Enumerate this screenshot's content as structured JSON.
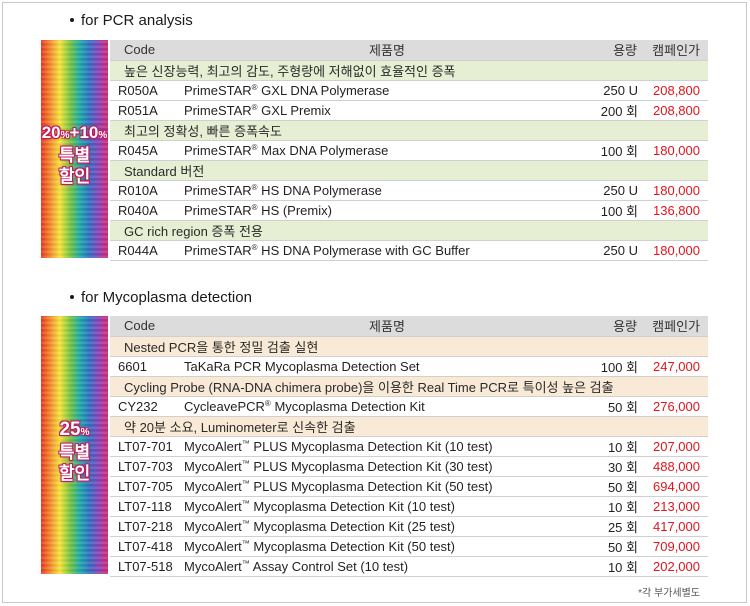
{
  "pcr": {
    "title": "for PCR analysis",
    "badge_pct": "20",
    "badge_pct_unit": "%",
    "badge_pct2": "+10",
    "badge_pct2_unit": "%",
    "badge_line1": "특별",
    "badge_line2": "할인",
    "headers": {
      "code": "Code",
      "name": "제품명",
      "qty": "용량",
      "price": "캠페인가"
    },
    "rows": [
      {
        "type": "cat",
        "text": "높은 신장능력, 최고의 감도, 주형량에 저해없이 효율적인 증폭"
      },
      {
        "type": "item",
        "code": "R050A",
        "name_a": "PrimeSTAR",
        "mark": "®",
        "name_b": " GXL DNA Polymerase",
        "qty": "250 U",
        "price": "208,800"
      },
      {
        "type": "item",
        "code": "R051A",
        "name_a": "PrimeSTAR",
        "mark": "®",
        "name_b": " GXL Premix",
        "qty": "200 회",
        "price": "208,800"
      },
      {
        "type": "cat",
        "text": "최고의 정확성, 빠른 증폭속도"
      },
      {
        "type": "item",
        "code": "R045A",
        "name_a": "PrimeSTAR",
        "mark": "®",
        "name_b": " Max DNA Polymerase",
        "qty": "100 회",
        "price": "180,000"
      },
      {
        "type": "cat",
        "text": "Standard 버전"
      },
      {
        "type": "item",
        "code": "R010A",
        "name_a": "PrimeSTAR",
        "mark": "®",
        "name_b": " HS DNA Polymerase",
        "qty": "250 U",
        "price": "180,000"
      },
      {
        "type": "item",
        "code": "R040A",
        "name_a": "PrimeSTAR",
        "mark": "®",
        "name_b": " HS (Premix)",
        "qty": "100 회",
        "price": "136,800"
      },
      {
        "type": "cat",
        "text": "GC rich region 증폭 전용"
      },
      {
        "type": "item",
        "code": "R044A",
        "name_a": "PrimeSTAR",
        "mark": "®",
        "name_b": " HS DNA Polymerase with GC Buffer",
        "qty": "250 U",
        "price": "180,000"
      }
    ]
  },
  "myco": {
    "title": "for Mycoplasma detection",
    "badge_pct": "25",
    "badge_pct_unit": "%",
    "badge_line1": "특별",
    "badge_line2": "할인",
    "headers": {
      "code": "Code",
      "name": "제품명",
      "qty": "용량",
      "price": "캠페인가"
    },
    "rows": [
      {
        "type": "cat",
        "text": "Nested PCR을 통한 정밀 검출 실현"
      },
      {
        "type": "item",
        "code": "6601",
        "name_a": "TaKaRa PCR Mycoplasma Detection Set",
        "mark": "",
        "name_b": "",
        "qty": "100 회",
        "price": "247,000"
      },
      {
        "type": "cat",
        "text": "Cycling Probe (RNA-DNA chimera probe)을 이용한 Real Time PCR로 특이성 높은 검출"
      },
      {
        "type": "item",
        "code": "CY232",
        "name_a": "CycleavePCR",
        "mark": "®",
        "name_b": " Mycoplasma Detection Kit",
        "qty": "50 회",
        "price": "276,000"
      },
      {
        "type": "cat",
        "text": "약 20분 소요, Luminometer로 신속한 검출"
      },
      {
        "type": "item",
        "code": "LT07-701",
        "name_a": "MycoAlert",
        "mark": "™",
        "name_b": " PLUS Mycoplasma Detection Kit (10 test)",
        "qty": "10 회",
        "price": "207,000"
      },
      {
        "type": "item",
        "code": "LT07-703",
        "name_a": "MycoAlert",
        "mark": "™",
        "name_b": " PLUS Mycoplasma Detection Kit (30 test)",
        "qty": "30 회",
        "price": "488,000"
      },
      {
        "type": "item",
        "code": "LT07-705",
        "name_a": "MycoAlert",
        "mark": "™",
        "name_b": " PLUS Mycoplasma Detection Kit (50 test)",
        "qty": "50 회",
        "price": "694,000"
      },
      {
        "type": "item",
        "code": "LT07-118",
        "name_a": "MycoAlert",
        "mark": "™",
        "name_b": " Mycoplasma Detection Kit (10 test)",
        "qty": "10 회",
        "price": "213,000"
      },
      {
        "type": "item",
        "code": "LT07-218",
        "name_a": "MycoAlert",
        "mark": "™",
        "name_b": " Mycoplasma Detection Kit (25 test)",
        "qty": "25 회",
        "price": "417,000"
      },
      {
        "type": "item",
        "code": "LT07-418",
        "name_a": "MycoAlert",
        "mark": "™",
        "name_b": " Mycoplasma Detection Kit (50 test)",
        "qty": "50 회",
        "price": "709,000"
      },
      {
        "type": "item",
        "code": "LT07-518",
        "name_a": "MycoAlert",
        "mark": "™",
        "name_b": " Assay Control Set (10 test)",
        "qty": "10 회",
        "price": "202,000"
      }
    ]
  },
  "note": "*각 부가세별도",
  "colors": {
    "price": "#e3141b",
    "pcr_category_bg": "#e6efd4",
    "myco_category_bg": "#f8ead6",
    "header_bg": "#dcdcdc"
  }
}
